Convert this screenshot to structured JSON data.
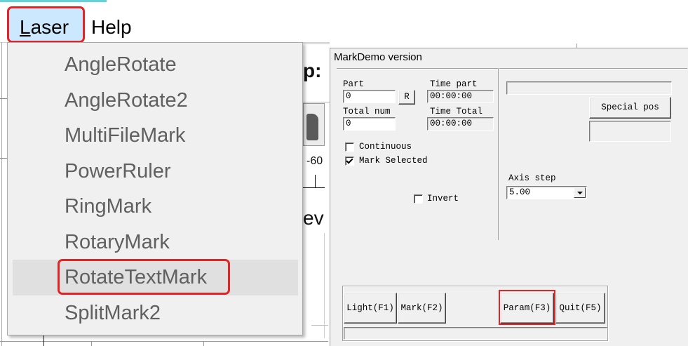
{
  "menubar": {
    "laser": "Laser",
    "help": "Help"
  },
  "laser_menu": {
    "items": [
      {
        "label": "AngleRotate",
        "hovered": false
      },
      {
        "label": "AngleRotate2",
        "hovered": false
      },
      {
        "label": "MultiFileMark",
        "hovered": false
      },
      {
        "label": "PowerRuler",
        "hovered": false
      },
      {
        "label": "RingMark",
        "hovered": false
      },
      {
        "label": "RotaryMark",
        "hovered": false
      },
      {
        "label": "RotateTextMark",
        "hovered": true
      },
      {
        "label": "SplitMark2",
        "hovered": false
      }
    ]
  },
  "background_window": {
    "fragments": [
      "p:",
      "-60",
      "ev"
    ]
  },
  "dialog": {
    "title": "MarkDemo version",
    "part": {
      "label": "Part",
      "value": "0"
    },
    "reset_button": "R",
    "time_part": {
      "label": "Time part",
      "value": "00:00:00"
    },
    "total_num": {
      "label": "Total num",
      "value": "0"
    },
    "time_total": {
      "label": "Time Total",
      "value": "00:00:00"
    },
    "continuous": {
      "label": "Continuous",
      "checked": false
    },
    "mark_selected": {
      "label": "Mark Selected",
      "checked": true
    },
    "invert": {
      "label": "Invert",
      "checked": false
    },
    "top_field_value": "",
    "special_pos_button": "Special pos",
    "special_pos_value": "",
    "axis_step": {
      "label": "Axis step",
      "value": "5.00"
    },
    "buttons": {
      "light": "Light(F1)",
      "mark": "Mark(F2)",
      "param": "Param(F3)",
      "quit": "Quit(F5)"
    },
    "status_text": ""
  },
  "icons": {
    "axis_step_dropdown": "chevron-down-icon",
    "checkbox_mark": "check-icon"
  },
  "colors": {
    "annotation_red": "#e42424",
    "menubar_active": "#cce8ff",
    "menu_hover": "#e0e0e0",
    "menu_text": "#606060",
    "dialog_bg": "#f0f0f0",
    "top_accent": "#63d3d9"
  }
}
